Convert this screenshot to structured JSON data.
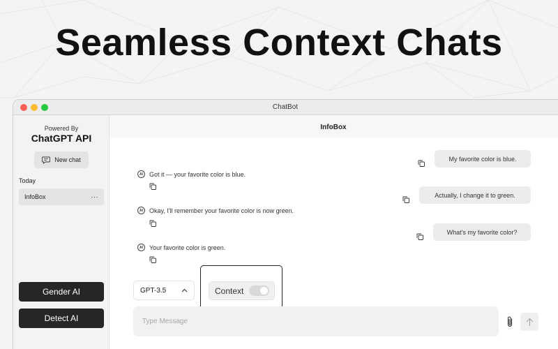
{
  "headline": "Seamless Context Chats",
  "window": {
    "title": "ChatBot"
  },
  "sidebar": {
    "powered_by": "Powered By",
    "brand": "ChatGPT API",
    "new_chat_label": "New chat",
    "section_label": "Today",
    "chats": [
      {
        "label": "InfoBox",
        "more_icon": "ellipsis-icon"
      }
    ],
    "gender_ai_label": "Gender AI",
    "detect_ai_label": "Detect AI"
  },
  "main": {
    "title": "InfoBox",
    "ai_badge": "AI",
    "messages": [
      {
        "role": "user",
        "text": "My favorite color is blue."
      },
      {
        "role": "assistant",
        "text": "Got it — your favorite color is blue."
      },
      {
        "role": "user",
        "text": "Actually, I change it to green."
      },
      {
        "role": "assistant",
        "text": "Okay, I'll remember your favorite color is now green."
      },
      {
        "role": "user",
        "text": "What's my favorite color?"
      },
      {
        "role": "assistant",
        "text": "Your favorite color is green."
      }
    ],
    "model_select": {
      "value": "GPT-3.5"
    },
    "context_toggle": {
      "label": "Context",
      "enabled": false
    },
    "input": {
      "placeholder": "Type Message",
      "value": ""
    }
  },
  "icons": [
    "chat-bubble-icon",
    "ellipsis-icon",
    "copy-icon",
    "ai-icon",
    "chevron-up-icon",
    "paperclip-icon",
    "arrow-up-icon"
  ],
  "colors": {
    "dark_button": "#262626",
    "accent_red": "#ff5f57",
    "accent_yellow": "#febc2e",
    "accent_green": "#28c840"
  }
}
